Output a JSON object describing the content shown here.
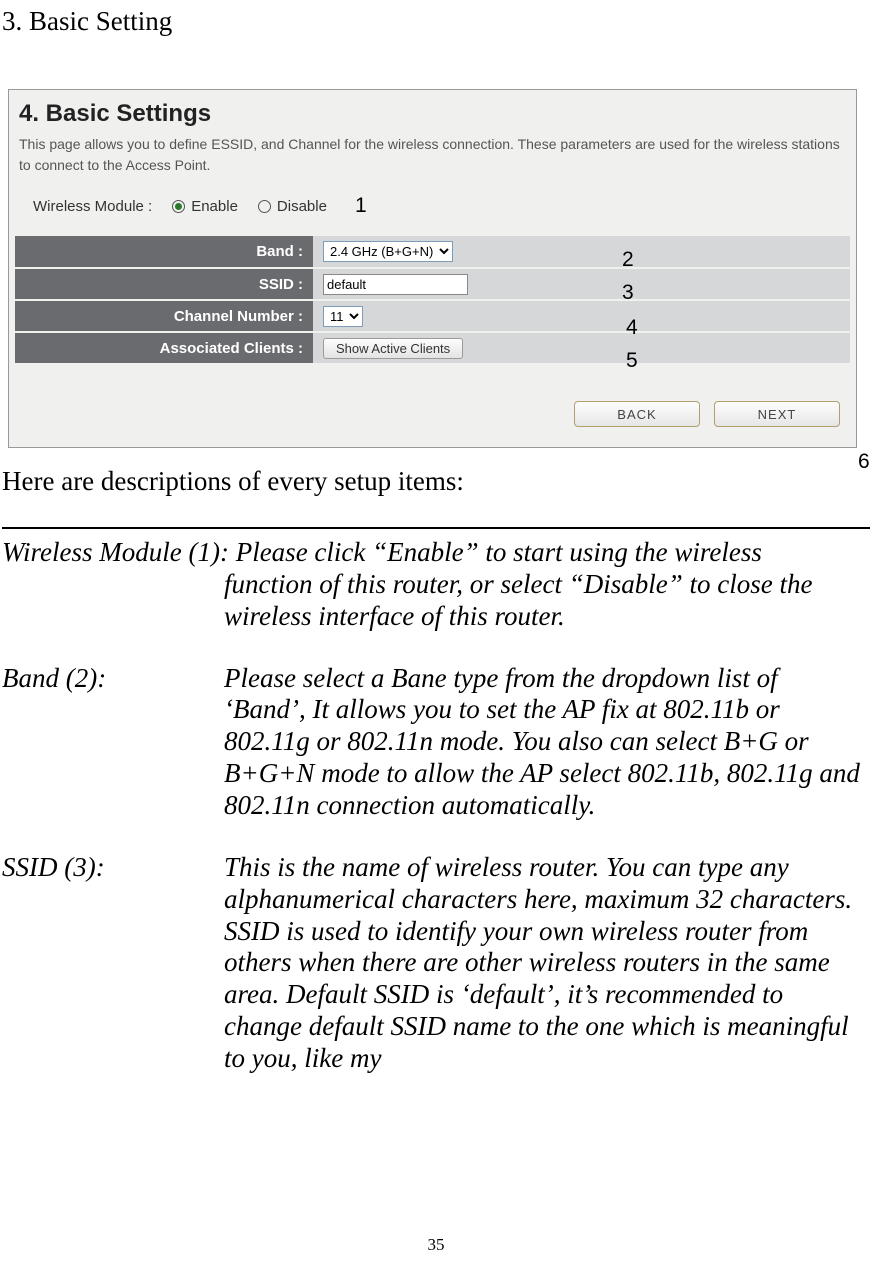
{
  "page_heading": "3. Basic Setting",
  "screenshot": {
    "title": "4. Basic Settings",
    "description": "This page allows you to define ESSID, and Channel for the wireless connection. These parameters are used for the wireless stations to connect to the Access Point.",
    "wireless_module_label": "Wireless Module :",
    "enable_label": "Enable",
    "disable_label": "Disable",
    "rows": {
      "band_label": "Band :",
      "band_value": "2.4 GHz (B+G+N)",
      "ssid_label": "SSID :",
      "ssid_value": "default",
      "channel_label": "Channel Number :",
      "channel_value": "11",
      "clients_label": "Associated Clients :",
      "clients_button": "Show Active Clients"
    },
    "back_button": "BACK",
    "next_button": "NEXT",
    "annotations": {
      "a1": "1",
      "a2": "2",
      "a3": "3",
      "a4": "4",
      "a5": "5",
      "a6": "6"
    }
  },
  "descriptions_intro": "Here are descriptions of every setup items:",
  "desc": {
    "wm_label": "Wireless Module (1): ",
    "wm_text": "Please click “Enable” to start using the wireless function of this router, or select “Disable” to close the wireless interface of this router.",
    "band_label": "Band (2):",
    "band_text": " Please select a Bane type from the dropdown list of ‘Band’, It allows you to set the AP fix at 802.11b or 802.11g or 802.11n mode. You also can select B+G or B+G+N mode to allow the AP select 802.11b, 802.11g and 802.11n connection automatically.",
    "ssid_label": "SSID (3):",
    "ssid_text": "This is the name of wireless router. You can type any alphanumerical characters here, maximum 32 characters. SSID is used to identify your own wireless router from others when there are other wireless routers in the same area. Default SSID is ‘default’, it’s recommended to change default SSID name to the one which is meaningful to you, like my"
  },
  "page_number": "35"
}
